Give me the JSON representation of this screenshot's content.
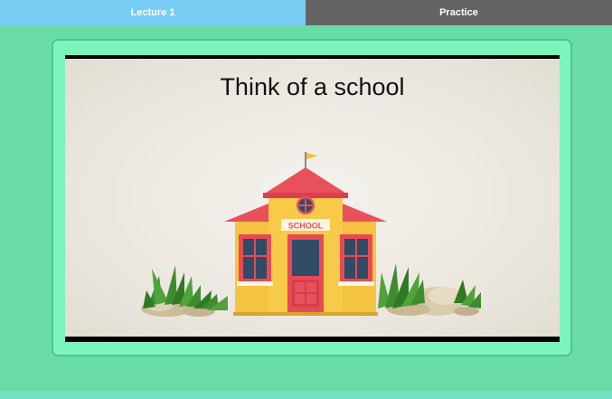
{
  "tabs": [
    {
      "label": "Lecture 1",
      "active": true
    },
    {
      "label": "Practice",
      "active": false
    }
  ],
  "slide": {
    "title": "Think of a school",
    "school_sign": "SCHOOL"
  },
  "colors": {
    "background": "#69dba6",
    "frame": "#7cf5bd",
    "tab_active": "#78cdf5",
    "tab_inactive": "#636363",
    "roof": "#e8505b",
    "wall": "#f5c242",
    "door": "#e84a55",
    "flag": "#f2c230"
  }
}
